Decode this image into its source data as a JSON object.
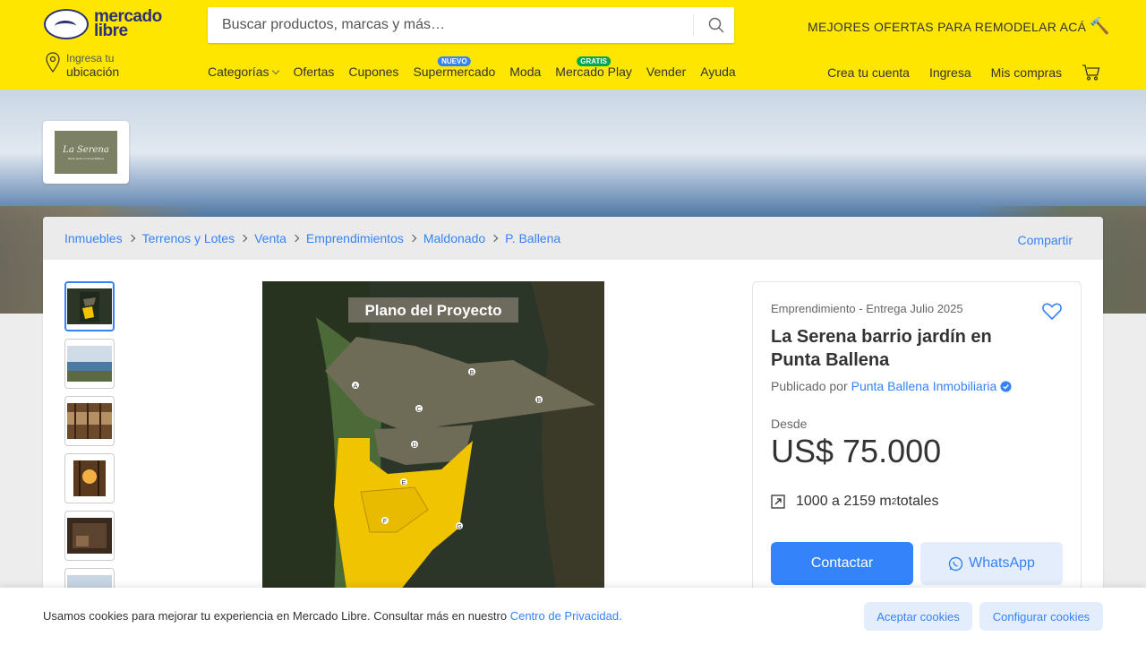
{
  "header": {
    "logo_text_line1": "mercado",
    "logo_text_line2": "libre",
    "search_placeholder": "Buscar productos, marcas y más…",
    "promo": "MEJORES OFERTAS PARA REMODELAR ACÁ",
    "location_small": "Ingresa tu",
    "location_big": "ubicación",
    "nav": [
      {
        "label": "Categorías"
      },
      {
        "label": "Ofertas"
      },
      {
        "label": "Cupones"
      },
      {
        "label": "Supermercado",
        "badge": "NUEVO"
      },
      {
        "label": "Moda"
      },
      {
        "label": "Mercado Play",
        "badge": "GRATIS"
      },
      {
        "label": "Vender"
      },
      {
        "label": "Ayuda"
      }
    ],
    "account": {
      "signup": "Crea tu cuenta",
      "login": "Ingresa",
      "purchases": "Mis compras"
    },
    "colors": {
      "brand_yellow": "#ffe600",
      "brand_blue": "#2d3277",
      "badge_new": "#3483fa",
      "badge_free": "#00a650"
    }
  },
  "store": {
    "brand": "La Serena",
    "tagline": "Barrio jardín en Punta Ballena"
  },
  "breadcrumbs": [
    "Inmuebles",
    "Terrenos y Lotes",
    "Venta",
    "Emprendimientos",
    "Maldonado",
    "P. Ballena"
  ],
  "share_label": "Compartir",
  "gallery": {
    "thumbnails": [
      "plan",
      "coast",
      "forest",
      "sunset-forest",
      "interior",
      "aerial"
    ],
    "main_image_title": "Plano del Proyecto",
    "lot_labels": [
      "A",
      "B",
      "C",
      "D",
      "E",
      "F",
      "G",
      "B"
    ]
  },
  "listing": {
    "subtitle": "Emprendimiento - Entrega Julio 2025",
    "title": "La Serena barrio jardín en Punta Ballena",
    "published_by": "Publicado por",
    "publisher": "Punta Ballena Inmobiliaria",
    "from_label": "Desde",
    "price": "US$ 75.000",
    "area_prefix": "1000 a 2159 m",
    "area_sup": "2",
    "area_suffix": " totales",
    "contact_button": "Contactar",
    "whatsapp_button": "WhatsApp",
    "accent_color": "#3483fa"
  },
  "cookie": {
    "text": "Usamos cookies para mejorar tu experiencia en Mercado Libre. Consultar más en nuestro ",
    "link": "Centro de Privacidad.",
    "accept": "Aceptar cookies",
    "configure": "Configurar cookies"
  }
}
